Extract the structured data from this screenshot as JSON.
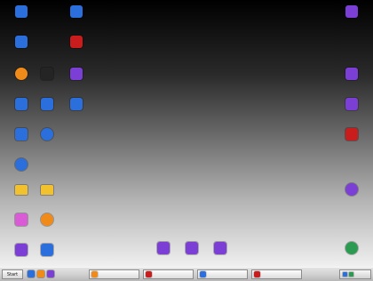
{
  "desktop": {
    "icons": [
      {
        "label": "",
        "icon": "blue-app-icon",
        "color": "#2a6fdb"
      },
      {
        "label": "",
        "icon": "blue-app-icon",
        "color": "#2a6fdb"
      },
      {
        "label": "",
        "icon": "purple-window-icon",
        "color": "#7b3fd6"
      },
      {
        "label": "",
        "icon": "blue-app-icon",
        "color": "#2a6fdb"
      },
      {
        "label": "",
        "icon": "red-app-icon",
        "color": "#c91c1c"
      },
      {
        "label": "",
        "icon": "purple-window-icon",
        "color": "#7b3fd6"
      },
      {
        "label": "",
        "icon": "orange-app-icon",
        "color": "#f08b1a"
      },
      {
        "label": "",
        "icon": "dark-app-icon",
        "color": "#242424"
      },
      {
        "label": "",
        "icon": "purple-window-icon",
        "color": "#7b3fd6"
      },
      {
        "label": "",
        "icon": "blue-app-icon",
        "color": "#2a6fdb"
      },
      {
        "label": "",
        "icon": "blue-app-icon",
        "color": "#2a6fdb"
      },
      {
        "label": "",
        "icon": "blue-app-icon",
        "color": "#2a6fdb"
      },
      {
        "label": "",
        "icon": "blue-app-icon",
        "color": "#2a6fdb"
      },
      {
        "label": "",
        "icon": "blue-app-icon",
        "color": "#2a6fdb"
      },
      {
        "label": "",
        "icon": "purple-window-icon",
        "color": "#7b3fd6"
      },
      {
        "label": "",
        "icon": "blue-app-icon",
        "color": "#2a6fdb"
      },
      {
        "label": "",
        "icon": "red-app-icon",
        "color": "#c91c1c"
      },
      {
        "label": "",
        "icon": "yellow-folder-icon",
        "color": "#f2c12e"
      },
      {
        "label": "",
        "icon": "yellow-folder-icon",
        "color": "#f2c12e"
      },
      {
        "label": "",
        "icon": "multicolor-app-icon",
        "color": "#d95bd6"
      },
      {
        "label": "",
        "icon": "orange-app-icon",
        "color": "#f08b1a"
      },
      {
        "label": "",
        "icon": "purple-window-icon",
        "color": "#7b3fd6"
      },
      {
        "label": "",
        "icon": "blue-app-icon",
        "color": "#2a6fdb"
      },
      {
        "label": "",
        "icon": "green-app-icon",
        "color": "#2c9b52"
      },
      {
        "label": "",
        "icon": "purple-window-icon",
        "color": "#7b3fd6"
      },
      {
        "label": "",
        "icon": "purple-window-icon",
        "color": "#7b3fd6"
      },
      {
        "label": "",
        "icon": "purple-window-icon",
        "color": "#7b3fd6"
      }
    ]
  },
  "taskbar": {
    "start_label": "Start",
    "quick_launch": [
      {
        "icon": "blue-app-icon",
        "color": "#2a6fdb"
      },
      {
        "icon": "orange-app-icon",
        "color": "#f08b1a"
      },
      {
        "icon": "purple-window-icon",
        "color": "#7b3fd6"
      }
    ],
    "tasks": [
      {
        "label": "",
        "icon": "orange-app-icon",
        "color": "#f08b1a"
      },
      {
        "label": "",
        "icon": "red-app-icon",
        "color": "#c91c1c"
      },
      {
        "label": "",
        "icon": "blue-app-icon",
        "color": "#2a6fdb"
      },
      {
        "label": "",
        "icon": "red-app-icon",
        "color": "#c91c1c"
      }
    ],
    "tray": {
      "icons": [
        {
          "icon": "network-icon",
          "color": "#2a6fdb"
        },
        {
          "icon": "volume-icon",
          "color": "#2c9b52"
        }
      ],
      "time": ""
    }
  }
}
